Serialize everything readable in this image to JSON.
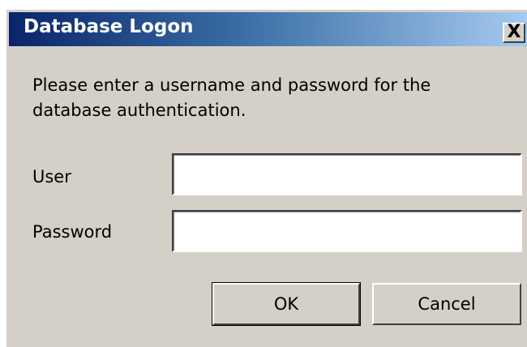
{
  "dialog": {
    "title": "Database Logon",
    "close_symbol": "X",
    "message": "Please enter a username and password for the database authentication.",
    "user_label": "User",
    "user_value": "",
    "password_label": "Password",
    "password_value": "",
    "ok_label": "OK",
    "cancel_label": "Cancel"
  },
  "colors": {
    "window_background": "#d4d0c8",
    "titlebar_start": "#0a246a",
    "titlebar_end": "#a6caf0",
    "title_text": "#ffffff"
  },
  "icons": {
    "close": "close-icon"
  }
}
